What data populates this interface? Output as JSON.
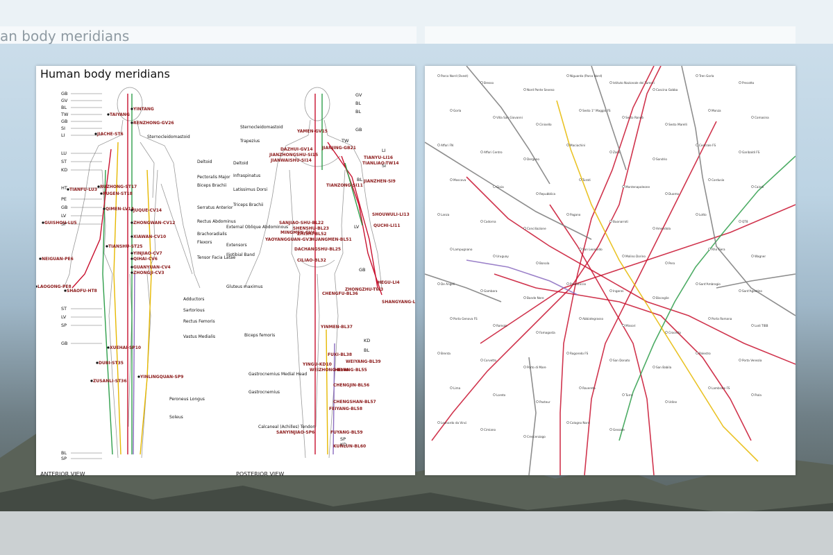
{
  "background": {
    "ghost_title": "an body meridians"
  },
  "meridian_card": {
    "title": "Human body meridians",
    "anterior_view_label": "ANTERIOR VIEW",
    "posterior_view_label": "POSTERIOR VIEW",
    "anterior_meridian_tags": [
      "GB",
      "GV",
      "BL",
      "TW",
      "GB",
      "SI",
      "LI",
      "LU",
      "ST",
      "KD",
      "HT",
      "PE",
      "GB",
      "LV",
      "SP",
      "ST",
      "LV",
      "SP",
      "GB",
      "BL",
      "SP"
    ],
    "anterior_points": [
      "YINTANG",
      "TAIYANG",
      "RENZHONG-GV26",
      "JIACHE-ST6",
      "TIANFU-LU3",
      "RUZHONG-ST17",
      "RUGEN-ST18",
      "QIMEN-LV14",
      "GUISHOU-LU5",
      "JUQUE-CV14",
      "ZHONGWAN-CV12",
      "XIAWAN-CV10",
      "TIANSHU-ST25",
      "YINJIAO-CV7",
      "QIHAI-CV6",
      "NEIGUAN-PE6",
      "GUANYUAN-CV4",
      "ZHONGJI-CV3",
      "LAOGONG-PE8",
      "SHAOFU-HT8",
      "XUEHAI-SP10",
      "DUBI-ST35",
      "YINLINGQUAN-SP9",
      "ZUSANLI-ST36"
    ],
    "anterior_muscles": [
      "Sternocleidomastoid",
      "Deltoid",
      "Pectoralis Major",
      "Biceps Brachii",
      "Serratus Anterior",
      "Rectus Abdominus",
      "Brachoradialis",
      "Flexors",
      "Tensor Facia Latae",
      "Adductors",
      "Sartorious",
      "Rectus Femoris",
      "Vastus Medialis",
      "Peroneus Longus",
      "Soleus"
    ],
    "posterior_meridian_tags": [
      "GV",
      "BL",
      "BL",
      "GB",
      "TW",
      "LI",
      "SI",
      "BL",
      "LV",
      "GB",
      "KD",
      "BL",
      "SP",
      "KD"
    ],
    "posterior_points": [
      "YAMEN-GV15",
      "DAZHUI-GV14",
      "JIANZHONGSHU-SI15",
      "JIANWAISHU-SI14",
      "JIANJING-GB21",
      "TIANYU-LI16",
      "TIANLIAO-TW14",
      "JIANZHEN-SI9",
      "TIANZONG-SI11",
      "SHOUWULI-LI13",
      "SANJIAO-SHU-BL22",
      "SHENSHU-BL23",
      "QUCHI-LI11",
      "ZHISHI-BL52",
      "MINGMEN-GV4",
      "YAOYANGGUAN-GV3",
      "HUANGMEN-BL51",
      "DACHANGSHU-BL25",
      "CILIAO-BL32",
      "ZHONGZHU-TW3",
      "HEGU-LI4",
      "CHENGFU-BL36",
      "SHANGYANG-LI1",
      "YINMEN-BL37",
      "FUXI-BL38",
      "WEIYANG-BL39",
      "YINGU-KD10",
      "WEIZHONG-BL40",
      "HEYANG-BL55",
      "CHENGJIN-BL56",
      "CHENGSHAN-BL57",
      "FEIYANG-BL58",
      "SANYINJIAO-SP6",
      "FUYANG-BL59",
      "KUNLUN-BL60"
    ],
    "posterior_muscles": [
      "Sternocleidomastoid",
      "Trapezius",
      "Deltoid",
      "Infraspinatus",
      "Latissimus Dorsi",
      "Triceps Brachii",
      "External Oblique Abdominous",
      "Extensors",
      "Iliotibial Band",
      "Gluteus maximus",
      "Biceps femoris",
      "Gastrocnemius Medial Head",
      "Gastrocnemius",
      "Calcaneal (Achilles) Tendon"
    ]
  },
  "map_card": {
    "stations": [
      "Parco Nord (Ovest)",
      "Bresso",
      "Nord Ponte Seveso",
      "Niguarda (Parco Nord)",
      "Istituto Nazionale dei Tumori",
      "Cascina Gobba",
      "Tren Gorla",
      "Precotto",
      "Gorla",
      "Villa San Giovanni",
      "Cinisello",
      "Sesto 1° Maggio FS",
      "Sesto Rondò",
      "Sesto Marelli",
      "Monza",
      "Comasina",
      "Affori FN",
      "Affori Centro",
      "Dergano",
      "Maciachini",
      "Zara",
      "Sondrio",
      "Centrale FS",
      "Garibaldi FS",
      "Moscova",
      "Gioia",
      "Repubblica",
      "Turati",
      "Montenapoleone",
      "Duomo",
      "Cordusio",
      "Cairoli",
      "Lanza",
      "Cadorna",
      "Conciliazione",
      "Pagano",
      "Buonarroti",
      "Amendola",
      "Lotto",
      "QT8",
      "Lampugnano",
      "Uruguay",
      "Bonola",
      "San Leonardo",
      "Molino Dorino",
      "Pero",
      "Rho Fiera",
      "Wagner",
      "De Angeli",
      "Gambara",
      "Bande Nere",
      "Primaticcio",
      "Inganni",
      "Bisceglie",
      "Sant'Ambrogio",
      "Sant'Agostino",
      "Porta Genova FS",
      "Romolo",
      "Famagosta",
      "Abbiategrasso",
      "Missori",
      "Crocetta",
      "Porta Romana",
      "Lodi TIBB",
      "Brenta",
      "Corvetto",
      "Porto di Mare",
      "Rogoredo FS",
      "San Donato",
      "San Babila",
      "Palestro",
      "Porta Venezia",
      "Lima",
      "Loreto",
      "Pasteur",
      "Rovereto",
      "Turro",
      "Udine",
      "Lambrate FS",
      "Piola",
      "Leonardo da Vinci",
      "Cimiano",
      "Crescenzago",
      "Cologno Nord",
      "Gessate"
    ]
  },
  "colors": {
    "red_line": "#c8102e",
    "green_line": "#2e9e4a",
    "yellow_line": "#e6b800",
    "purple_line": "#8a6bbf",
    "grey_line": "#7a7a7a",
    "label_red": "#8b1a1a"
  }
}
